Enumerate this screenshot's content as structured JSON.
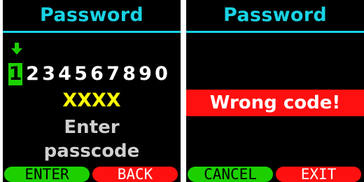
{
  "colors": {
    "title": "#18d3e4",
    "green": "#1cd000",
    "red": "#ff1010",
    "yellow": "#ffff00",
    "background": "#000000"
  },
  "left_screen": {
    "title": "Password",
    "cursor_icon": "down-arrow-icon",
    "digits": [
      "1",
      "2",
      "3",
      "4",
      "5",
      "6",
      "7",
      "8",
      "9",
      "0"
    ],
    "selected_digit_index": 0,
    "code": "XXXX",
    "prompt_line1": "Enter",
    "prompt_line2": "passcode",
    "softkey_left": "ENTER",
    "softkey_right": "BACK"
  },
  "right_screen": {
    "title": "Password",
    "error": "Wrong code!",
    "softkey_left": "CANCEL",
    "softkey_right": "EXIT"
  }
}
